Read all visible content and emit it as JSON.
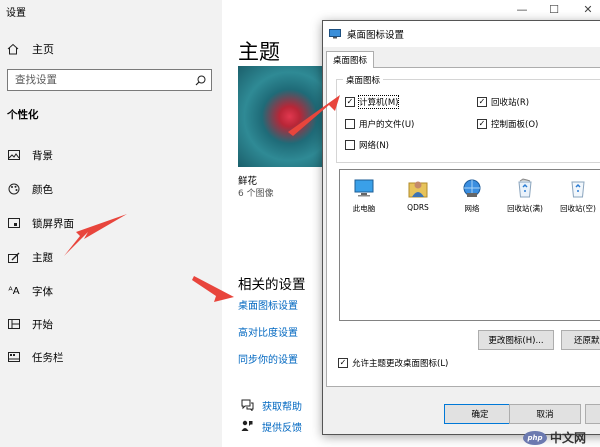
{
  "window": {
    "title": "设置"
  },
  "sidebar": {
    "home_label": "主页",
    "search_placeholder": "查找设置",
    "section": "个性化",
    "items": [
      {
        "label": "背景",
        "icon": "image-icon"
      },
      {
        "label": "颜色",
        "icon": "palette-icon"
      },
      {
        "label": "锁屏界面",
        "icon": "lockscreen-icon"
      },
      {
        "label": "主题",
        "icon": "brush-icon"
      },
      {
        "label": "字体",
        "icon": "font-icon"
      },
      {
        "label": "开始",
        "icon": "start-icon"
      },
      {
        "label": "任务栏",
        "icon": "taskbar-icon"
      }
    ]
  },
  "main": {
    "title": "主题",
    "theme": {
      "name": "鲜花",
      "count": "6 个图像"
    },
    "related_title": "相关的设置",
    "related_links": [
      "桌面图标设置",
      "高对比度设置",
      "同步你的设置"
    ],
    "help": [
      {
        "label": "获取帮助",
        "icon": "help-chat-icon"
      },
      {
        "label": "提供反馈",
        "icon": "feedback-icon"
      }
    ]
  },
  "caption_buttons": {
    "minimize": "—",
    "maximize": "☐",
    "close": "✕"
  },
  "dialog": {
    "title": "桌面图标设置",
    "tab": "桌面图标",
    "group_title": "桌面图标",
    "checkboxes": [
      {
        "label": "计算机(M)",
        "checked": true
      },
      {
        "label": "回收站(R)",
        "checked": true
      },
      {
        "label": "用户的文件(U)",
        "checked": false
      },
      {
        "label": "控制面板(O)",
        "checked": true
      },
      {
        "label": "网络(N)",
        "checked": false
      }
    ],
    "icons": [
      {
        "label": "此电脑",
        "icon": "computer-icon"
      },
      {
        "label": "QDRS",
        "icon": "user-folder-icon"
      },
      {
        "label": "网络",
        "icon": "network-icon"
      },
      {
        "label": "回收站(满)",
        "icon": "recycle-bin-full-icon"
      },
      {
        "label": "回收站(空)",
        "icon": "recycle-bin-empty-icon"
      }
    ],
    "change_icon_btn": "更改图标(H)...",
    "restore_btn": "还原默认",
    "allow_themes": {
      "label": "允许主题更改桌面图标(L)",
      "checked": true
    },
    "ok": "确定",
    "cancel": "取消",
    "apply": "应"
  },
  "watermark": {
    "logo": "php",
    "text": "中文网"
  },
  "colors": {
    "link": "#0067c0",
    "arrow": "#e8453c",
    "sidebar_bg": "#f2f2f2",
    "dialog_bg": "#f0f0f0"
  }
}
